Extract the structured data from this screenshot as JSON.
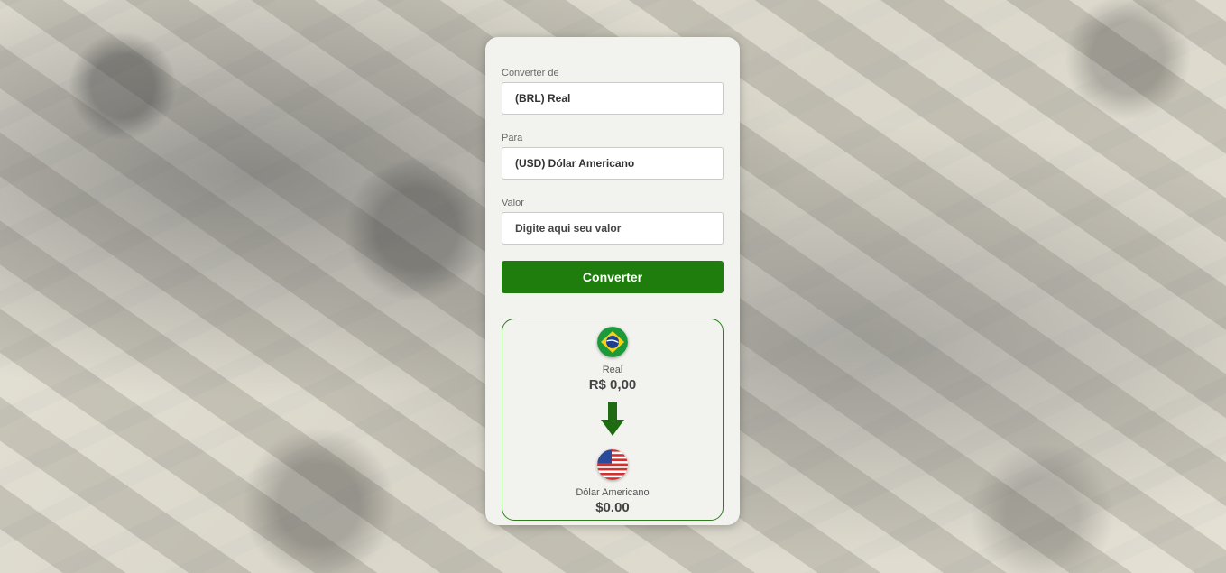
{
  "form": {
    "from_label": "Converter de",
    "from_value": "(BRL) Real",
    "to_label": "Para",
    "to_value": "(USD) Dólar Americano",
    "amount_label": "Valor",
    "amount_placeholder": "Digite aqui seu valor",
    "convert_button": "Converter"
  },
  "result": {
    "from": {
      "flag_icon": "brazil-flag-icon",
      "name": "Real",
      "value": "R$ 0,00"
    },
    "arrow_icon": "arrow-down-icon",
    "to": {
      "flag_icon": "usa-flag-icon",
      "name": "Dólar Americano",
      "value": "$0.00"
    }
  },
  "colors": {
    "accent": "#1e7d0c",
    "card_bg": "#f2f2ef",
    "border_green": "#2f7e1e"
  }
}
